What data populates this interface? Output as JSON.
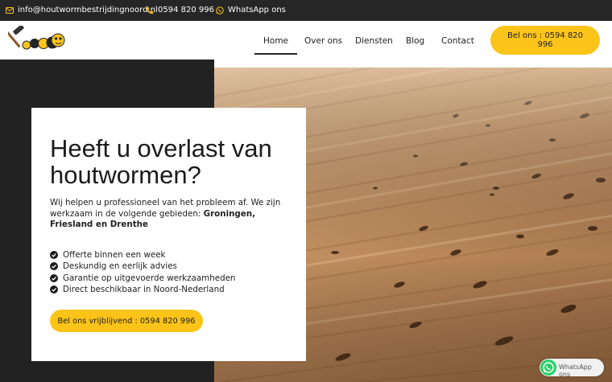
{
  "topbar": {
    "email": "info@houtwormbestrijdingnoord.nl",
    "phone": "0594 820 996",
    "whatsapp": "WhatsApp ons",
    "icons": [
      "mail-icon",
      "phone-icon",
      "whatsapp-icon"
    ]
  },
  "nav": {
    "items": [
      {
        "label": "Home",
        "active": true
      },
      {
        "label": "Over ons"
      },
      {
        "label": "Diensten"
      },
      {
        "label": "Blog"
      },
      {
        "label": "Contact"
      }
    ],
    "cta_label": "Bel ons : 0594 820 996"
  },
  "hero": {
    "heading": "Heeft u overlast van houtwormen?",
    "intro_1": "Wij helpen u professioneel van het probleem af. We zijn werkzaam in de volgende gebieden:",
    "intro_regions": "Groningen, Friesland en Drenthe",
    "bullets": [
      "Offerte binnen een week",
      "Deskundig en eerlijk advies",
      "Garantie op uitgevoerde werkzaamheden",
      "Direct beschikbaar in Noord-Nederland"
    ],
    "button_label": "Bel ons vrijblijvend : 0594 820 996"
  },
  "floating": {
    "whatsapp_label": "WhatsApp ons"
  },
  "colors": {
    "accent": "#fcc419",
    "dark": "#222222",
    "topbar": "#262626"
  }
}
